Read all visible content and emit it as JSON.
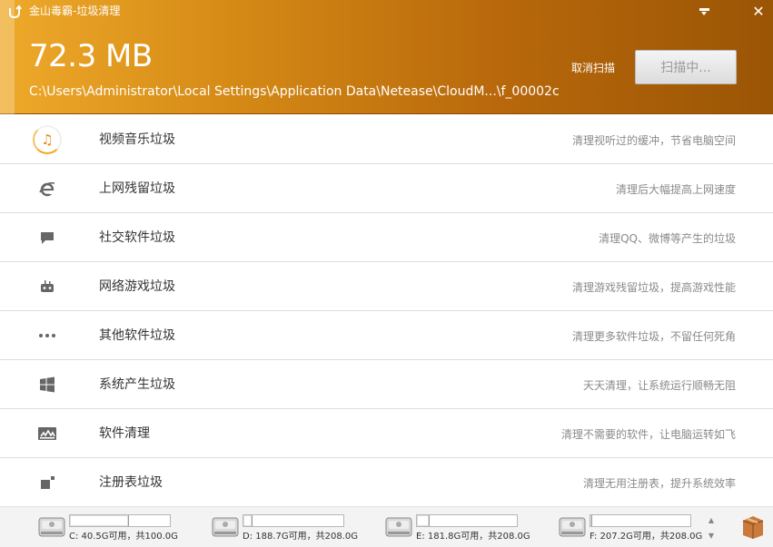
{
  "window": {
    "title": "金山毒霸-垃圾清理"
  },
  "header": {
    "size": "72.3 MB",
    "path": "C:\\Users\\Administrator\\Local Settings\\Application Data\\Netease\\CloudM...\\f_00002c",
    "cancel_label": "取消扫描",
    "scan_label": "扫描中...",
    "bg_colors": [
      "#eea92a",
      "#9a5505"
    ]
  },
  "categories": [
    {
      "icon": "music-note-icon",
      "title": "视频音乐垃圾",
      "desc": "清理视听过的缓冲，节省电脑空间"
    },
    {
      "icon": "internet-explorer-icon",
      "title": "上网残留垃圾",
      "desc": "清理后大幅提高上网速度"
    },
    {
      "icon": "chat-bubble-icon",
      "title": "社交软件垃圾",
      "desc": "清理QQ、微博等产生的垃圾"
    },
    {
      "icon": "game-controller-icon",
      "title": "网络游戏垃圾",
      "desc": "清理游戏残留垃圾，提高游戏性能"
    },
    {
      "icon": "more-dots-icon",
      "title": "其他软件垃圾",
      "desc": "清理更多软件垃圾，不留任何死角"
    },
    {
      "icon": "windows-logo-icon",
      "title": "系统产生垃圾",
      "desc": "天天清理，让系统运行顺畅无阻"
    },
    {
      "icon": "software-icon",
      "title": "软件清理",
      "desc": "清理不需要的软件，让电脑运转如飞"
    },
    {
      "icon": "registry-icon",
      "title": "注册表垃圾",
      "desc": "清理无用注册表，提升系统效率"
    }
  ],
  "drives": [
    {
      "text": "C: 40.5G可用，共100.0G",
      "used_fraction": 0.595
    },
    {
      "text": "D: 188.7G可用，共208.0G",
      "used_fraction": 0.093
    },
    {
      "text": "E: 181.8G可用，共208.0G",
      "used_fraction": 0.126
    },
    {
      "text": "F: 207.2G可用，共208.0G",
      "used_fraction": 0.004
    }
  ]
}
